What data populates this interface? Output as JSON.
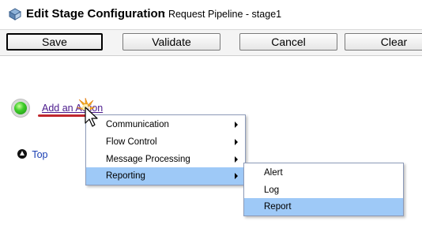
{
  "header": {
    "title": "Edit Stage Configuration",
    "subtitle": ": Request Pipeline - stage1"
  },
  "toolbar": {
    "save_label": "Save",
    "validate_label": "Validate",
    "cancel_label": "Cancel",
    "clear_label": "Clear"
  },
  "stage": {
    "add_action_label": "Add an Action",
    "top_label": "Top"
  },
  "context_menu": {
    "items": [
      {
        "label": "Communication",
        "has_submenu": true
      },
      {
        "label": "Flow Control",
        "has_submenu": true
      },
      {
        "label": "Message Processing",
        "has_submenu": true
      },
      {
        "label": "Reporting",
        "has_submenu": true,
        "highlighted": true
      }
    ]
  },
  "submenu": {
    "items": [
      {
        "label": "Alert"
      },
      {
        "label": "Log"
      },
      {
        "label": "Report",
        "highlighted": true
      }
    ]
  },
  "colors": {
    "menu_highlight": "#9ec9f7",
    "link": "#4b1a8c",
    "annotation_underline": "#c0272d",
    "status": "#3fcd2a"
  }
}
